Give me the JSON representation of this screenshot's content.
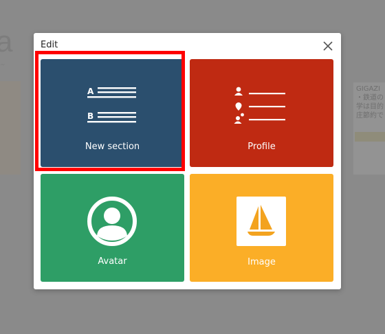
{
  "background": {
    "title_fragment": "a",
    "side_text": "GIGAZI\n・鉄道の\n学は目的\n庄節約で"
  },
  "dialog": {
    "title": "Edit"
  },
  "tiles": [
    {
      "label": "New section",
      "color": "#2b4f6e",
      "icon": "section-ab-lines-icon"
    },
    {
      "label": "Profile",
      "color": "#bf2a12",
      "icon": "profile-list-icon"
    },
    {
      "label": "Avatar",
      "color": "#2e9e66",
      "icon": "avatar-person-icon"
    },
    {
      "label": "Image",
      "color": "#fbae27",
      "icon": "sailboat-image-icon"
    }
  ],
  "colors": {
    "highlight": "#ff0000",
    "overlay": "#8a8a8a"
  }
}
